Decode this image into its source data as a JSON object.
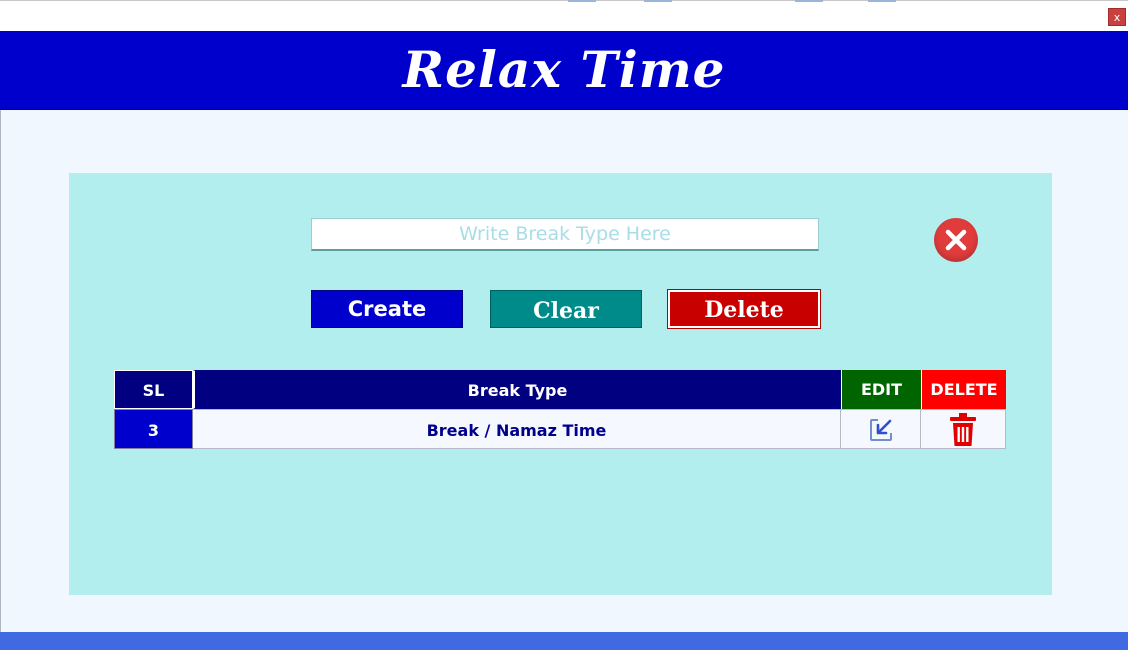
{
  "window": {
    "close_label": "x"
  },
  "header": {
    "title": "Relax Time"
  },
  "form": {
    "break_type_placeholder": "Write Break Type Here",
    "break_type_value": "",
    "create_label": "Create",
    "clear_label": "Clear",
    "delete_label": "Delete"
  },
  "table": {
    "columns": [
      "SL",
      "Break Type",
      "EDIT",
      "DELETE"
    ],
    "rows": [
      {
        "sl": "3",
        "break_type": "Break / Namaz Time",
        "edit_icon": "edit-icon",
        "delete_icon": "trash-icon"
      }
    ]
  },
  "colors": {
    "header_bg": "#0000CD",
    "panel_bg": "#B2EEEE",
    "create_bg": "#0000CD",
    "clear_bg": "#008B8B",
    "delete_bg": "#C80000",
    "col_header_bg": "#000080",
    "edit_header_bg": "#006400",
    "delete_header_bg": "#FF0000",
    "footer_bg": "#4169E1"
  }
}
